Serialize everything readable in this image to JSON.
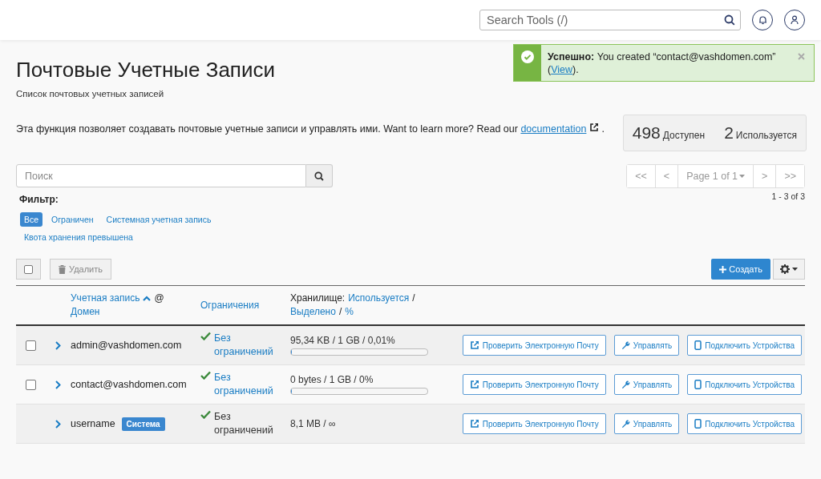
{
  "topbar": {
    "search": {
      "placeholder": "Search Tools (/)"
    }
  },
  "notice": {
    "message_before": "**Успешно:** You created “contact@vashdomen.com” (",
    "link": "View",
    "message_after": ")."
  },
  "page": {
    "title": "Почтовые Учетные Записи",
    "subtitle": "Список почтовых учетных записей",
    "description_before": "Эта функция позволяет создавать почтовые учетные записи и управлять ими. Want to learn more? Read our ",
    "description_link": "documentation",
    "description_after": " ."
  },
  "stats": [
    {
      "value": "498",
      "label": "Доступен"
    },
    {
      "value": "2",
      "label": "Используется"
    }
  ],
  "search": {
    "placeholder": "Поиск"
  },
  "pagination": {
    "buttons": [
      {
        "label": "<<"
      },
      {
        "label": "<"
      },
      {
        "label": "Page 1 of 1",
        "kind": "dropdown"
      },
      {
        "label": ">"
      },
      {
        "label": ">>"
      }
    ],
    "range": "1 - 3 of 3"
  },
  "filter": {
    "label": "Фильтр:",
    "options": [
      {
        "label": "Все",
        "selected": true
      },
      {
        "label": "Ограничен",
        "selected": false
      },
      {
        "label": "Системная учетная запись",
        "selected": false
      },
      {
        "label": "Квота хранения превышена",
        "selected": false
      }
    ]
  },
  "toolbar": {
    "select_all": {
      "checked": false
    },
    "delete": "Удалить",
    "create": "Создать"
  },
  "columns": [
    {
      "parts": [
        {
          "text": "Учетная запись",
          "link": true,
          "sort": true
        },
        {
          "text": "@",
          "link": false
        },
        {
          "text": "Домен",
          "link": true
        }
      ]
    },
    {
      "parts": [
        {
          "text": "Ограничения",
          "link": true
        }
      ]
    },
    {
      "parts": [
        {
          "text": "Хранилище:",
          "link": false
        },
        {
          "text": "Используется",
          "link": true
        },
        {
          "text": "/",
          "link": false
        },
        {
          "text": "Выделено",
          "link": true
        },
        {
          "text": "/",
          "link": false
        },
        {
          "text": "%",
          "link": true
        }
      ]
    }
  ],
  "rows": [
    {
      "checkbox": {
        "checked": false
      },
      "account": "admin@vashdomen.com",
      "restriction": {
        "text": "Без ограничений",
        "link": true
      },
      "storage": {
        "text": "95,34 KB / 1 GB / 0,01%",
        "level": 0.0001
      },
      "actions": [
        {
          "kind": "external",
          "label": "Проверить Электронную Почту"
        },
        {
          "kind": "wrench",
          "label": "Управлять"
        },
        {
          "kind": "device",
          "label": "Подключить Устройства"
        }
      ]
    },
    {
      "checkbox": {
        "checked": false
      },
      "account": "contact@vashdomen.com",
      "restriction": {
        "text": "Без ограничений",
        "link": true
      },
      "storage": {
        "text": "0 bytes / 1 GB / 0%",
        "level": 0
      },
      "actions": [
        {
          "kind": "external",
          "label": "Проверить Электронную Почту"
        },
        {
          "kind": "wrench",
          "label": "Управлять"
        },
        {
          "kind": "device",
          "label": "Подключить Устройства"
        }
      ]
    },
    {
      "account": "username",
      "badge": "Система",
      "restriction": {
        "text": "Без ограничений",
        "link": false
      },
      "storage": {
        "text": "8,1 MB / ∞"
      },
      "actions": [
        {
          "kind": "external",
          "label": "Проверить Электронную Почту"
        },
        {
          "kind": "wrench",
          "label": "Управлять"
        },
        {
          "kind": "device",
          "label": "Подключить Устройства"
        }
      ]
    }
  ]
}
